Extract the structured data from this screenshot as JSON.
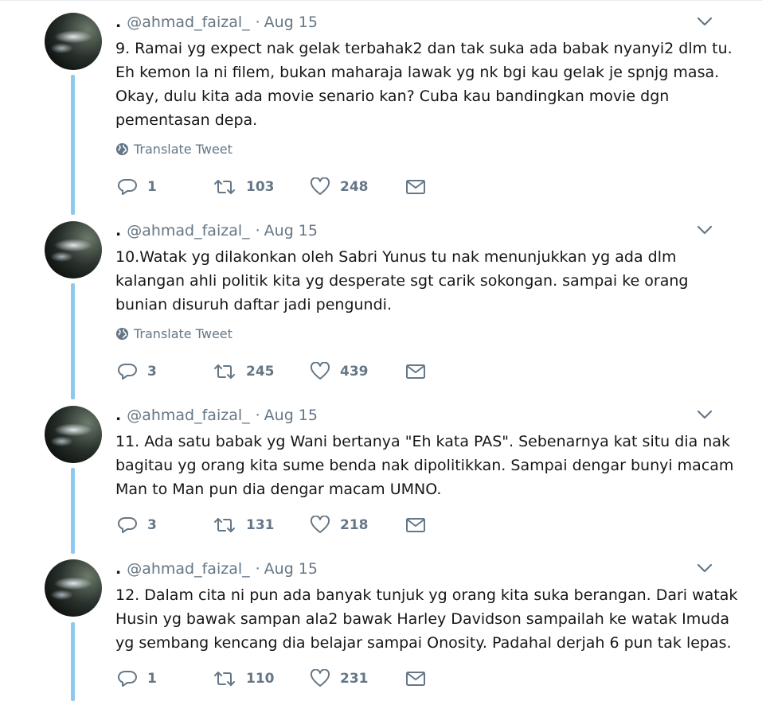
{
  "tweets": [
    {
      "name": ".",
      "handle": "@ahmad_faizal_",
      "separator": "·",
      "date": "Aug 15",
      "lines": [
        "9. Ramai yg expect nak gelak terbahak2 dan tak suka ada babak nyanyi2 dlm tu.",
        "Eh kemon la ni filem, bukan maharaja lawak yg nk bgi kau gelak je spnjg masa.",
        "Okay, dulu kita ada movie senario kan? Cuba kau bandingkan movie dgn",
        "pementasan depa."
      ],
      "translate": "Translate Tweet",
      "replies": "1",
      "retweets": "103",
      "likes": "248"
    },
    {
      "name": ".",
      "handle": "@ahmad_faizal_",
      "separator": "·",
      "date": "Aug 15",
      "lines": [
        "10.Watak yg dilakonkan oleh Sabri Yunus tu nak menunjukkan yg ada dlm",
        "kalangan ahli politik kita yg desperate sgt carik sokongan. sampai ke orang",
        "bunian disuruh daftar jadi pengundi."
      ],
      "translate": "Translate Tweet",
      "replies": "3",
      "retweets": "245",
      "likes": "439"
    },
    {
      "name": ".",
      "handle": "@ahmad_faizal_",
      "separator": "·",
      "date": "Aug 15",
      "lines": [
        "11. Ada satu babak yg Wani bertanya \"Eh kata PAS\". Sebenarnya kat situ dia nak",
        "bagitau yg orang kita sume benda nak dipolitikkan. Sampai dengar bunyi macam",
        "Man to Man pun dia dengar macam UMNO."
      ],
      "replies": "3",
      "retweets": "131",
      "likes": "218"
    },
    {
      "name": ".",
      "handle": "@ahmad_faizal_",
      "separator": "·",
      "date": "Aug 15",
      "lines": [
        "12. Dalam cita ni pun ada banyak tunjuk yg orang kita suka berangan. Dari watak",
        "Husin yg bawak sampan ala2 bawak Harley Davidson sampailah ke watak Imuda",
        "yg sembang kencang dia belajar sampai Onosity. Padahal derjah 6 pun tak lepas."
      ],
      "replies": "1",
      "retweets": "110",
      "likes": "231"
    }
  ],
  "icons": {
    "reply": "reply-icon",
    "retweet": "retweet-icon",
    "like": "heart-icon",
    "dm": "envelope-icon",
    "caret": "chevron-down-icon",
    "globe": "globe-icon"
  },
  "colors": {
    "thread_line": "#8ec8ee",
    "secondary_text": "#657786",
    "primary_text": "#14171a"
  }
}
